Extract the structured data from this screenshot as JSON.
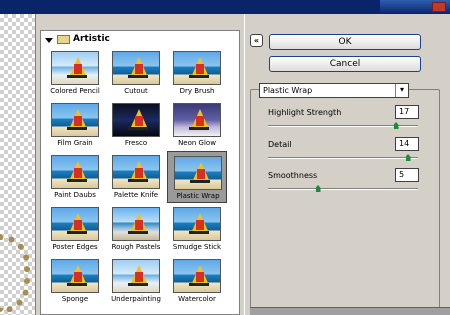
{
  "gallery": {
    "category": "Artistic",
    "filters": [
      {
        "label": "Colored Pencil",
        "style": "pale"
      },
      {
        "label": "Cutout",
        "style": "normal"
      },
      {
        "label": "Dry Brush",
        "style": "normal"
      },
      {
        "label": "Film Grain",
        "style": "normal"
      },
      {
        "label": "Fresco",
        "style": "dark"
      },
      {
        "label": "Neon Glow",
        "style": "purple"
      },
      {
        "label": "Paint Daubs",
        "style": "normal"
      },
      {
        "label": "Palette Knife",
        "style": "normal"
      },
      {
        "label": "Plastic Wrap",
        "style": "normal"
      },
      {
        "label": "Poster Edges",
        "style": "normal"
      },
      {
        "label": "Rough Pastels",
        "style": "rough"
      },
      {
        "label": "Smudge Stick",
        "style": "normal"
      },
      {
        "label": "Sponge",
        "style": "normal"
      },
      {
        "label": "Underpainting",
        "style": "pale"
      },
      {
        "label": "Watercolor",
        "style": "normal"
      }
    ],
    "selected": "Plastic Wrap"
  },
  "panel": {
    "collapse_symbol": "«",
    "ok_label": "OK",
    "cancel_label": "Cancel",
    "filter_select": "Plastic Wrap",
    "params": [
      {
        "label": "Highlight Strength",
        "value": "17",
        "fraction": 0.85
      },
      {
        "label": "Detail",
        "value": "14",
        "fraction": 0.93
      },
      {
        "label": "Smoothness",
        "value": "5",
        "fraction": 0.33
      }
    ]
  },
  "colors": {
    "button_border": "#1c3f94",
    "slider_knob": "#1e8b3a",
    "selected_tile": "#9a9a9a"
  }
}
